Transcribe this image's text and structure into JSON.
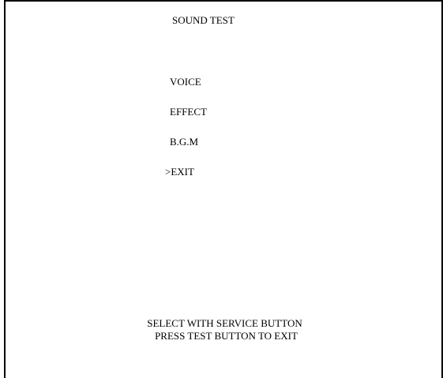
{
  "title": "SOUND TEST",
  "menu": {
    "items": [
      {
        "label": "VOICE"
      },
      {
        "label": "EFFECT"
      },
      {
        "label": "B.G.M"
      },
      {
        "label": ">EXIT"
      }
    ],
    "selected_index": 3
  },
  "instructions": {
    "line1": "SELECT WITH SERVICE BUTTON",
    "line2": "PRESS TEST BUTTON TO EXIT"
  },
  "colors": {
    "background": "#ffffff",
    "text": "#000000",
    "frame": "#000000"
  }
}
